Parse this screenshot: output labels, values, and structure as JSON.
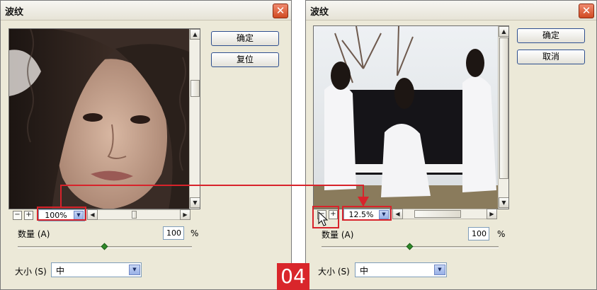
{
  "left_dialog": {
    "title": "波纹",
    "buttons": {
      "ok": "确定",
      "reset": "复位"
    },
    "zoom": "100%",
    "zoom_minus": "−",
    "zoom_plus": "+",
    "amount_label": "数量 (A)",
    "amount_value": "100",
    "amount_unit": "%",
    "amount_slider": 0.5,
    "size_label": "大小 (S)",
    "size_value": "中"
  },
  "right_dialog": {
    "title": "波纹",
    "buttons": {
      "ok": "确定",
      "cancel": "取消"
    },
    "zoom": "12.5%",
    "zoom_minus": "−",
    "zoom_plus": "+",
    "amount_label": "数量 (A)",
    "amount_value": "100",
    "amount_unit": "%",
    "amount_slider": 0.5,
    "size_label": "大小 (S)",
    "size_value": "中"
  },
  "step_badge": "04",
  "icons": {
    "close": "close-icon",
    "scroll_up": "arrow-up-icon",
    "scroll_down": "arrow-down-icon",
    "scroll_left": "arrow-left-icon",
    "scroll_right": "arrow-right-icon",
    "dropdown": "chevron-down-icon",
    "cursor": "mouse-pointer-icon"
  },
  "colors": {
    "highlight": "#d8232b",
    "badge_bg": "#d9262b",
    "close_button": "#d04a22",
    "dialog_bg": "#ece9d8",
    "slider_thumb": "#2f8a28"
  }
}
